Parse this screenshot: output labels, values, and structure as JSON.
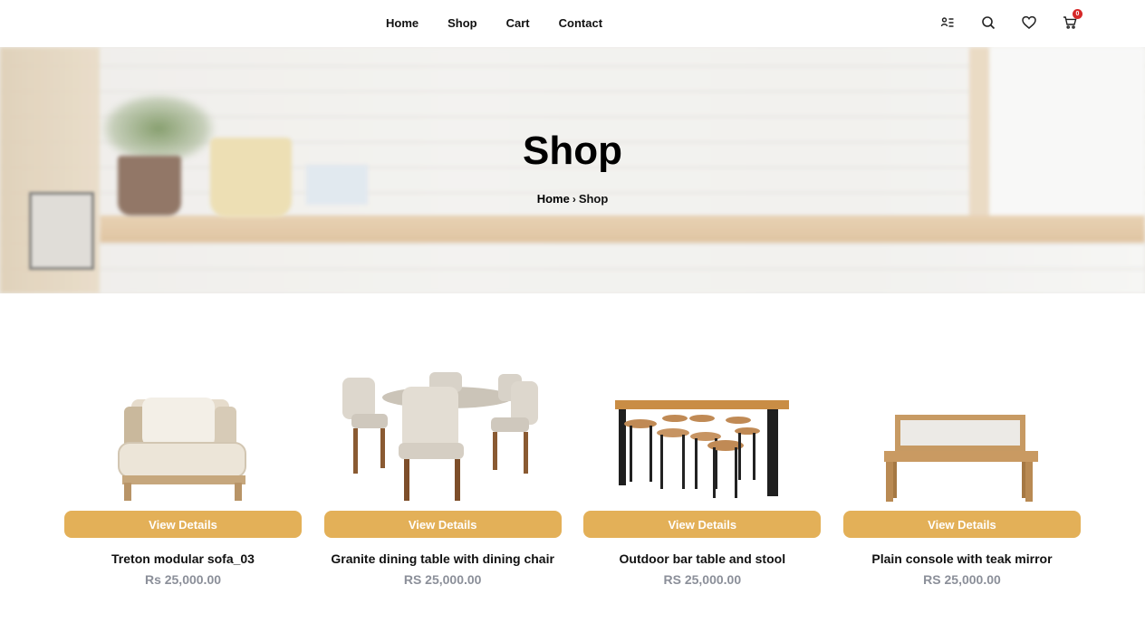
{
  "nav": {
    "items": [
      {
        "label": "Home"
      },
      {
        "label": "Shop"
      },
      {
        "label": "Cart"
      },
      {
        "label": "Contact"
      }
    ]
  },
  "header_icons": {
    "account": "account-icon",
    "search": "search-icon",
    "wishlist": "heart-icon",
    "cart": "cart-icon",
    "cart_count": "0"
  },
  "hero": {
    "title": "Shop",
    "breadcrumb": {
      "home": "Home",
      "separator": "›",
      "current": "Shop"
    }
  },
  "products": [
    {
      "name": "Treton modular sofa_03",
      "price": "Rs 25,000.00",
      "button": "View Details",
      "image": "sofa-image"
    },
    {
      "name": "Granite dining table with dining chair",
      "price": "RS 25,000.00",
      "button": "View Details",
      "image": "dining-set-image"
    },
    {
      "name": "Outdoor bar table and stool",
      "price": "RS 25,000.00",
      "button": "View Details",
      "image": "bar-table-image"
    },
    {
      "name": "Plain console with teak mirror",
      "price": "RS 25,000.00",
      "button": "View Details",
      "image": "console-image"
    }
  ],
  "colors": {
    "accent": "#e3b058",
    "price": "#8b8f99",
    "badge": "#d62828"
  }
}
